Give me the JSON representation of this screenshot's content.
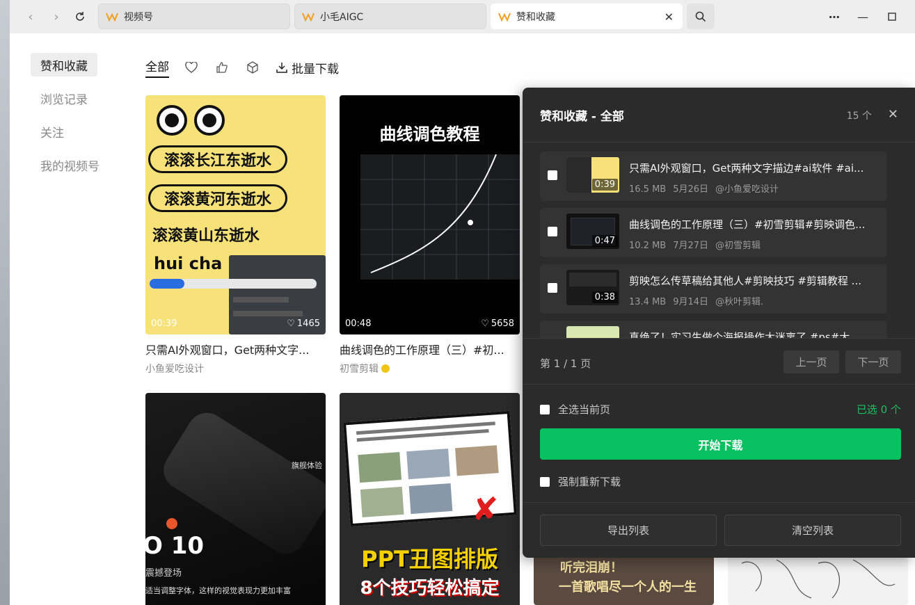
{
  "tabs": [
    {
      "label": "视频号"
    },
    {
      "label": "小毛AIGC"
    },
    {
      "label": "赞和收藏"
    }
  ],
  "sidebar": {
    "items": [
      {
        "label": "赞和收藏"
      },
      {
        "label": "浏览记录"
      },
      {
        "label": "关注"
      },
      {
        "label": "我的视频号"
      }
    ]
  },
  "filters": {
    "all_label": "全部",
    "batch_label": "批量下载"
  },
  "cards": [
    {
      "title": "只需AI外观窗口，Get两种文字...",
      "author": "小鱼爱吃设计",
      "duration": "00:39",
      "likes": "1465",
      "thumb_text": [
        "滚滚长江东逝水",
        "滚滚黄河东逝水",
        "滚滚黄山东逝水",
        "hui cha"
      ]
    },
    {
      "title": "曲线调色的工作原理（三）#初...",
      "author": "初雪剪辑",
      "duration": "00:48",
      "likes": "5658",
      "thumb_text": [
        "曲线调色教程"
      ]
    },
    {
      "thumb_text": [
        "旗舰体验",
        "O 10",
        "震撼登场",
        "适当调整字体，这样的视觉表现力更加丰富"
      ]
    },
    {
      "thumb_text": [
        "PPT丑图排版",
        "8个技巧轻松搞定"
      ]
    },
    {
      "thumb_text": [
        "听完泪崩！",
        "一首歌唱尽一个人的一生"
      ]
    }
  ],
  "panel": {
    "title": "赞和收藏 - 全部",
    "count": "15 个",
    "rows": [
      {
        "title": "只需AI外观窗口，Get两种文字描边#ai软件 #ai...",
        "duration": "0:39",
        "size": "16.5 MB",
        "date": "5月26日",
        "author": "@小鱼爱吃设计"
      },
      {
        "title": "曲线调色的工作原理（三）#初雪剪辑#剪映调色...",
        "duration": "0:47",
        "size": "10.2 MB",
        "date": "7月27日",
        "author": "@初雪剪辑"
      },
      {
        "title": "剪映怎么传草稿给其他人#剪映技巧 #剪辑教程 ...",
        "duration": "0:38",
        "size": "13.4 MB",
        "date": "9月14日",
        "author": "@秋叶剪辑."
      },
      {
        "title": "真绝了！实习生做个海报操作太迷离了 #ps#大...",
        "duration": "",
        "size": "",
        "date": "",
        "author": ""
      }
    ],
    "page_info": "第 1 / 1 页",
    "prev_label": "上一页",
    "next_label": "下一页",
    "select_all_label": "全选当前页",
    "selected_label": "已选 0 个",
    "start_label": "开始下载",
    "force_label": "强制重新下载",
    "export_label": "导出列表",
    "clear_label": "清空列表"
  },
  "colors": {
    "accent": "#07c160",
    "panel_bg": "#2b2b2b",
    "tab_logo": "#f0a020"
  }
}
